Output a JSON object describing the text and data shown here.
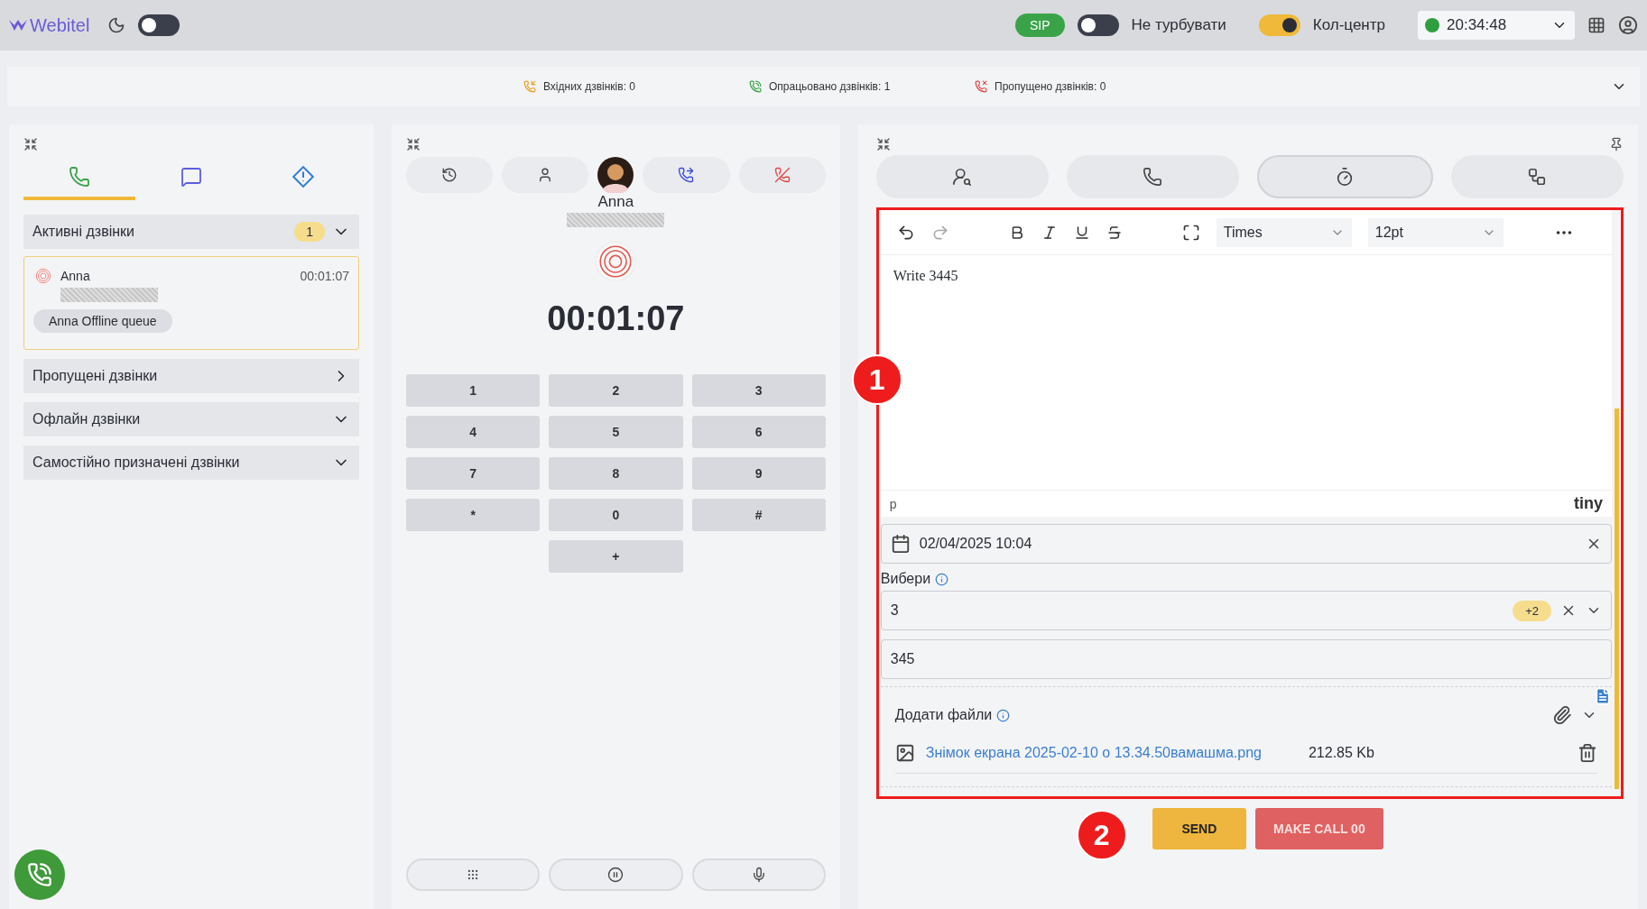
{
  "header": {
    "logo": "Webitel",
    "night_mode": false,
    "sip": "SIP",
    "toggles": [
      {
        "label": "Не турбувати",
        "on": false
      },
      {
        "label": "Кол-центр",
        "on": true
      }
    ],
    "status": {
      "time": "20:34:48",
      "color": "#2e9e3e"
    }
  },
  "stats": [
    {
      "kind": "incoming",
      "label": "Вхідних дзвінків: 0"
    },
    {
      "kind": "handled",
      "label": "Опрацьовано дзвінків: 1"
    },
    {
      "kind": "missed",
      "label": "Пропущено дзвінків: 0"
    }
  ],
  "left": {
    "tabs": [
      {
        "kind": "calls",
        "selected": true
      },
      {
        "kind": "chats",
        "selected": false
      },
      {
        "kind": "alerts",
        "selected": false
      }
    ],
    "sections": [
      {
        "title": "Активні дзвінки",
        "count": "1",
        "kind": "dropdown",
        "calls": [
          {
            "name": "Anna",
            "time": "00:01:07",
            "queue": "Anna Offline queue"
          }
        ]
      },
      {
        "title": "Пропущені дзвінки",
        "kind": "link"
      },
      {
        "title": "Офлайн дзвінки",
        "kind": "dropdown"
      },
      {
        "title": "Самостійно призначені дзвінки",
        "kind": "dropdown"
      }
    ]
  },
  "call": {
    "actions": [
      {
        "kind": "history"
      },
      {
        "kind": "contact"
      },
      {
        "kind": "avatar"
      },
      {
        "kind": "transfer"
      },
      {
        "kind": "hangup"
      }
    ],
    "name": "Anna",
    "timer": "00:01:07",
    "keys": [
      "1",
      "2",
      "3",
      "4",
      "5",
      "6",
      "7",
      "8",
      "9",
      "*",
      "0",
      "#",
      "+"
    ],
    "controls": [
      {
        "kind": "keypad"
      },
      {
        "kind": "hold"
      },
      {
        "kind": "mic"
      }
    ]
  },
  "work": {
    "tabs": [
      {
        "kind": "client",
        "selected": false
      },
      {
        "kind": "call",
        "selected": false
      },
      {
        "kind": "timer",
        "selected": true
      },
      {
        "kind": "flow",
        "selected": false
      }
    ],
    "editor": {
      "font": "Times",
      "size": "12pt",
      "content": "Write 3445",
      "path": "p",
      "brand": "tiny"
    },
    "date": "02/04/2025 10:04",
    "select": {
      "label": "Вибери",
      "value": "3",
      "extra": "+2"
    },
    "text_value": "345",
    "files": {
      "label": "Додати файли",
      "items": [
        {
          "name": "Знімок екрана 2025-02-10 о 13.34.50вамашма.png",
          "size": "212.85 Kb"
        }
      ]
    },
    "actions": [
      {
        "kind": "primary",
        "label": "SEND"
      },
      {
        "kind": "danger",
        "label": "MAKE CALL 00"
      }
    ]
  },
  "annotations": [
    {
      "label": "1"
    },
    {
      "label": "2"
    }
  ]
}
